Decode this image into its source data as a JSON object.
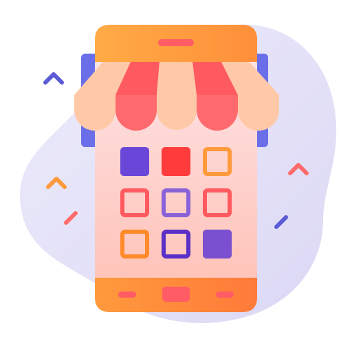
{
  "illustration": {
    "subject": "mobile-shop-icon",
    "colors": {
      "blob": "#e6e3f7",
      "phone_body_top": "#fbdcdf",
      "phone_body_bottom": "#ffc4b8",
      "phone_header": "#ffa23d",
      "phone_footer": "#ff8a3a",
      "speaker": "#ff5c66",
      "awning_light": "#ffc8a6",
      "awning_red": "#ff5a5f",
      "back_panel": "#6a6ee8",
      "sparkle_blue": "#5b5bd6",
      "sparkle_orange": "#ff9a3c",
      "sparkle_red": "#ff6b6b"
    },
    "app_grid": [
      {
        "style": "filled",
        "color": "#6a47d8"
      },
      {
        "style": "filled",
        "color": "#ff3b3b"
      },
      {
        "style": "outline",
        "color": "#ff9a3c"
      },
      {
        "style": "outline",
        "color": "#ff5a5f"
      },
      {
        "style": "outline",
        "color": "#8a62d8"
      },
      {
        "style": "outline",
        "color": "#ff5a5f"
      },
      {
        "style": "outline",
        "color": "#ff8a2a"
      },
      {
        "style": "outline",
        "color": "#5a2fc8"
      },
      {
        "style": "filled",
        "color": "#7a4fd0"
      }
    ]
  }
}
